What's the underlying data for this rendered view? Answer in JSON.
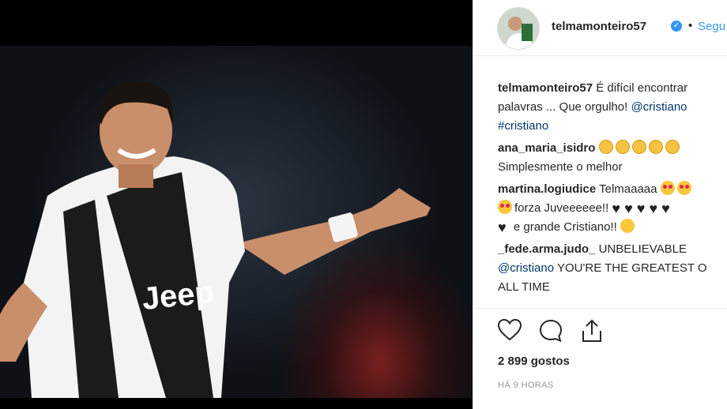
{
  "post": {
    "username": "telmamonteiro57",
    "verified": true,
    "separator": "•",
    "follow_label": "Segu"
  },
  "comments": [
    {
      "user": "telmamonteiro57",
      "lines": [
        "É difícil encontrar",
        "palavras ... Que orgulho!",
        "@cristiano",
        "#cristiano"
      ]
    },
    {
      "user": "ana_maria_isidro",
      "emoji": "clap-emoji x5",
      "line2": "Simplesmente o melhor"
    },
    {
      "user": "martina.logiudice",
      "text1": "Telmaaaaa",
      "text2": "forza Juveeeeee!!",
      "text3": "e grande Cristiano!!"
    },
    {
      "user": "_fede.arma.judo_",
      "text1": "UNBELIEVABLE",
      "mention": "@cristiano",
      "text2": "YOU'RE THE GREATEST O",
      "text3": "ALL TIME"
    }
  ],
  "likes": "2 899 gostos",
  "timestamp": "HÁ 9 HORAS",
  "colors": {
    "link": "#003569",
    "follow": "#3897f0",
    "verified": "#3897f0",
    "meta": "#999999"
  },
  "icons": [
    "heart-icon",
    "comment-icon",
    "share-icon",
    "verified-badge-icon"
  ]
}
